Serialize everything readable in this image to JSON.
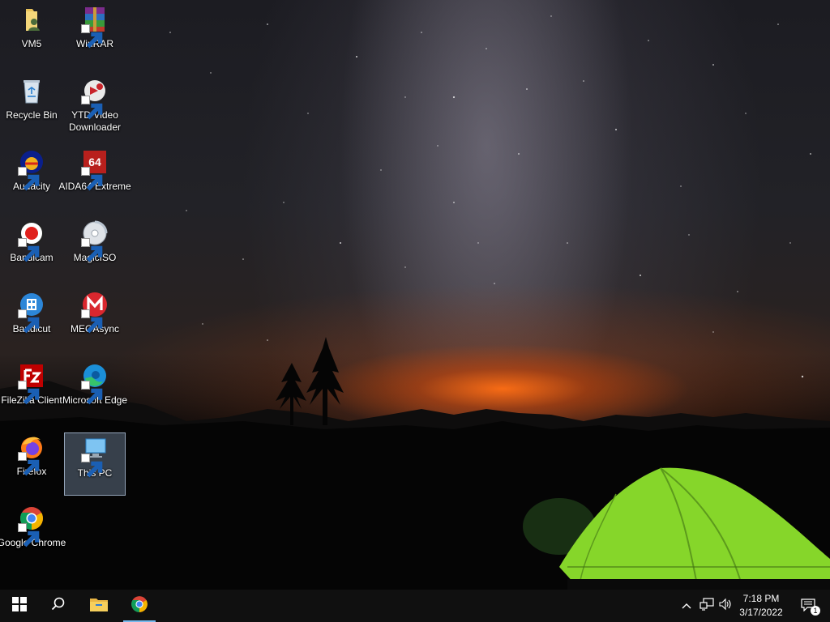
{
  "desktop": {
    "icons": [
      {
        "label": "VM5",
        "icon": "folder-user-icon"
      },
      {
        "label": "WinRAR",
        "icon": "winrar-icon"
      },
      {
        "label": "Recycle Bin",
        "icon": "recycle-bin-icon"
      },
      {
        "label": "YTD Video Downloader",
        "icon": "ytd-icon"
      },
      {
        "label": "Audacity",
        "icon": "audacity-icon"
      },
      {
        "label": "AIDA64 Extreme",
        "icon": "aida64-icon"
      },
      {
        "label": "Bandicam",
        "icon": "bandicam-icon"
      },
      {
        "label": "MagicISO",
        "icon": "magiciso-icon"
      },
      {
        "label": "Bandicut",
        "icon": "bandicut-icon"
      },
      {
        "label": "MEGAsync",
        "icon": "megasync-icon"
      },
      {
        "label": "FileZilla Client",
        "icon": "filezilla-icon"
      },
      {
        "label": "Microsoft Edge",
        "icon": "edge-icon"
      },
      {
        "label": "Firefox",
        "icon": "firefox-icon"
      },
      {
        "label": "This PC",
        "icon": "this-pc-icon",
        "selected": true
      },
      {
        "label": "Google Chrome",
        "icon": "chrome-icon"
      }
    ]
  },
  "taskbar": {
    "start_icon": "windows-start-icon",
    "search_icon": "search-icon",
    "pinned": [
      {
        "name": "File Explorer",
        "icon": "file-explorer-icon"
      },
      {
        "name": "Google Chrome",
        "icon": "chrome-icon",
        "active": true
      }
    ],
    "tray": {
      "icons": [
        "chevron-up-icon",
        "network-icon",
        "volume-icon"
      ],
      "time": "7:18 PM",
      "date": "3/17/2022",
      "notification_count": "1"
    }
  },
  "colors": {
    "taskbar_bg": "#101010",
    "active_indicator": "#76b9ed",
    "selection_bg": "#96afcd"
  }
}
